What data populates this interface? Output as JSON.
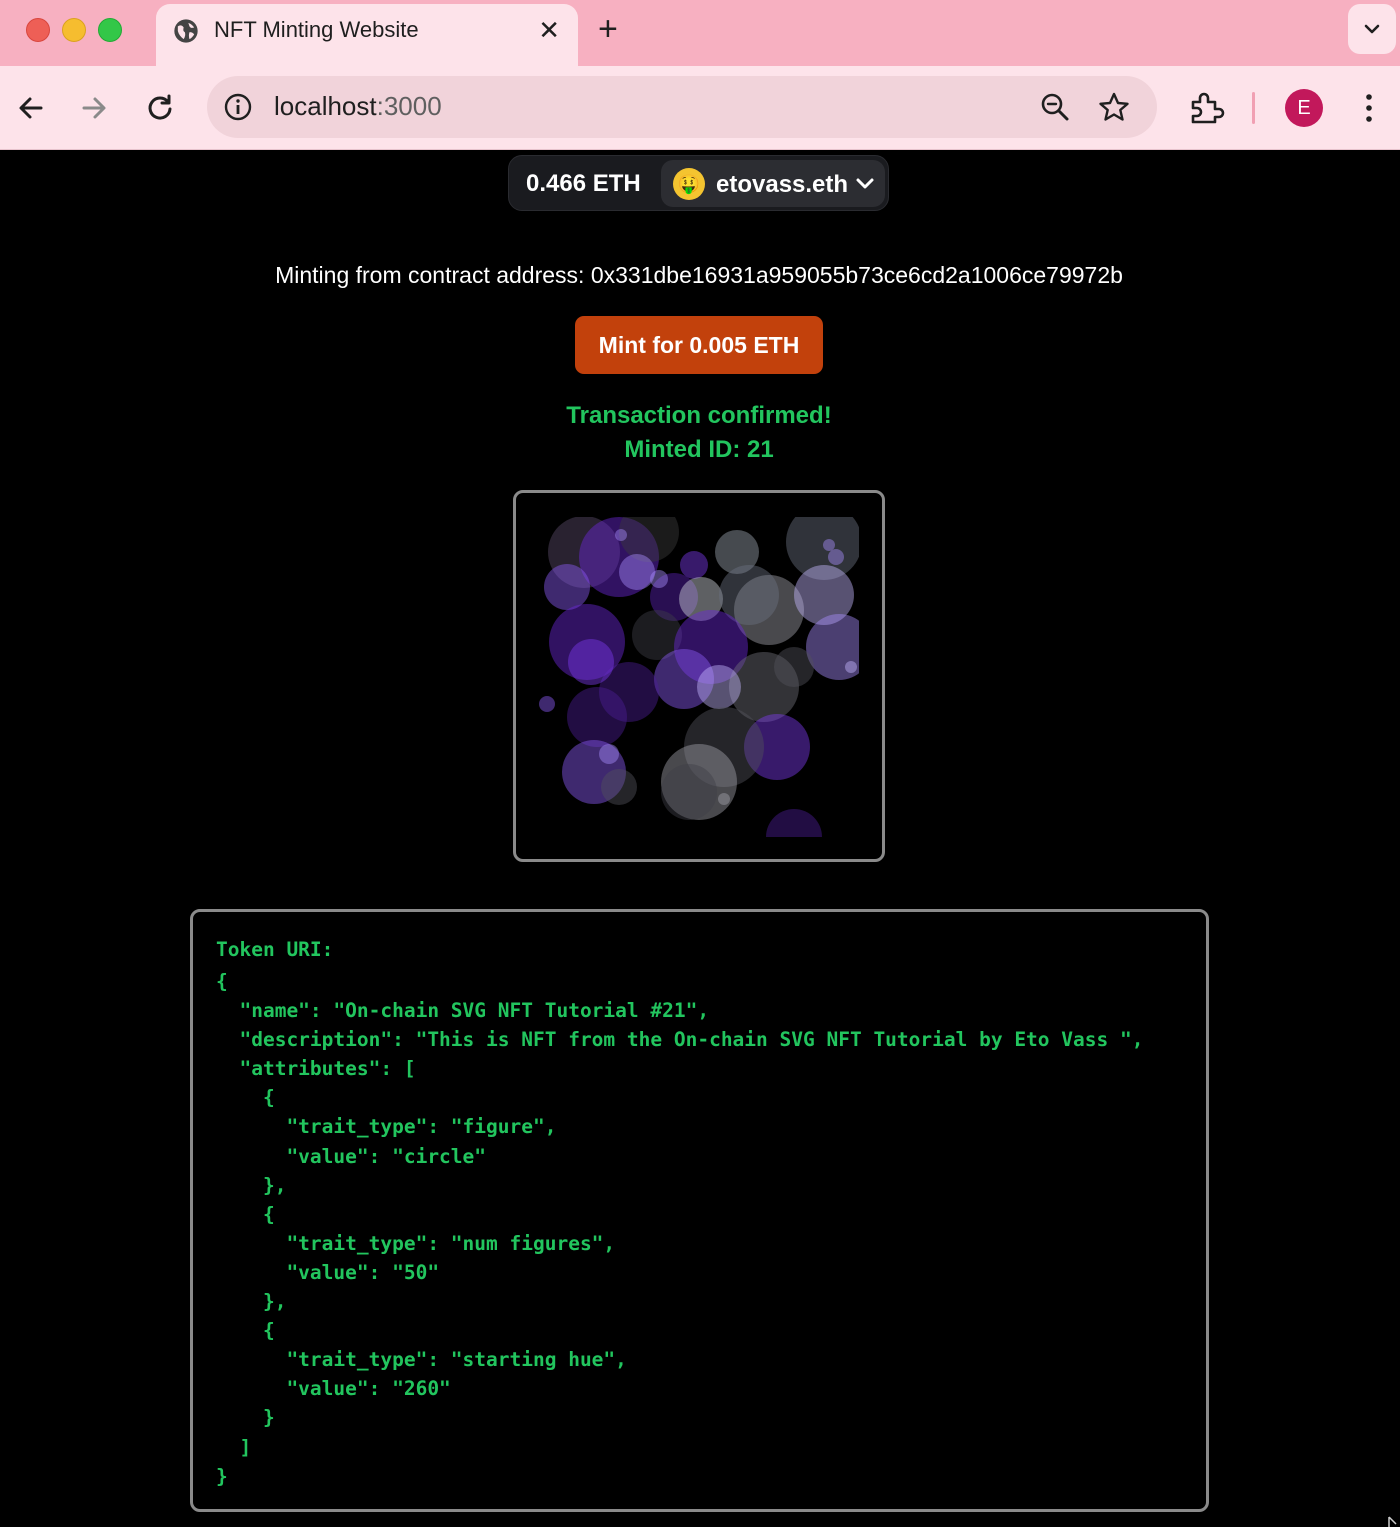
{
  "browser": {
    "tab_title": "NFT Minting Website",
    "tab_close": "✕",
    "new_tab": "+",
    "url_host": "localhost",
    "url_port": ":3000",
    "avatar_initial": "E"
  },
  "wallet": {
    "balance": "0.466 ETH",
    "emoji": "🤑",
    "ens_name": "etovass.eth"
  },
  "page": {
    "contract_text": "Minting from contract address: 0x331dbe16931a959055b73ce6cd2a1006ce79972b",
    "mint_button": "Mint for 0.005 ETH",
    "status_confirmed": "Transaction confirmed!",
    "status_minted_id": "Minted ID: 21"
  },
  "token_uri": {
    "title": "Token URI:",
    "json_text": "{\n  \"name\": \"On-chain SVG NFT Tutorial #21\",\n  \"description\": \"This is NFT from the On-chain SVG NFT Tutorial by Eto Vass \",\n  \"attributes\": [\n    {\n      \"trait_type\": \"figure\",\n      \"value\": \"circle\"\n    },\n    {\n      \"trait_type\": \"num figures\",\n      \"value\": \"50\"\n    },\n    {\n      \"trait_type\": \"starting hue\",\n      \"value\": \"260\"\n    }\n  ]\n}"
  },
  "colors": {
    "tab_bar": "#f7b0c1",
    "toolbar": "#fde3ea",
    "mint_button": "#c2410c",
    "success_green": "#22c55e",
    "nft_circle_base": "#6d28d9"
  }
}
